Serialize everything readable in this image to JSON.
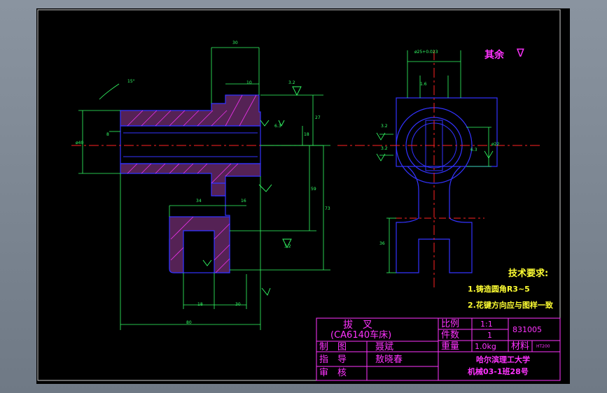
{
  "colors": {
    "background": "#000000",
    "outline": "#3333ff",
    "dimension": "#33ff66",
    "hatch": "#ff33ff",
    "centerline": "#ff2222",
    "title_block": "#ff33ff",
    "notes": "#ffff33"
  },
  "annotation": {
    "other_label": "其余",
    "roughness_symbol": "∇"
  },
  "tech_requirements": {
    "title": "技术要求:",
    "items": [
      "1.铸造圆角R3~5",
      "2.花键方向应与图样一致"
    ]
  },
  "title_block": {
    "part_name": "拔　叉",
    "machine": "(CA6140车床)",
    "scale_label": "比例",
    "scale_value": "1:1",
    "qty_label": "件数",
    "qty_value": "1",
    "weight_label": "重量",
    "weight_value": "1.0kg",
    "material_label": "材料",
    "material_value": "HT200",
    "drawing_no": "831005",
    "drawn_label": "制　图",
    "drawn_name": "聂斌",
    "guide_label": "指　导",
    "guide_name": "敖晓春",
    "review_label": "审　核",
    "review_name": "",
    "school": "哈尔滨理工大学",
    "class_info": "机械03-1班28号"
  },
  "dimensions": {
    "d30": "30",
    "d10a": "10",
    "d18": "18",
    "d27": "27",
    "d40": "40",
    "d59": "59",
    "d73": "73",
    "d34": "34",
    "d16": "16",
    "d30b": "30",
    "d80": "80",
    "d8": "8",
    "d36": "36",
    "angle": "15°",
    "roughness_32": "3.2",
    "roughness_63": "6.3",
    "roughness_16": "1.6",
    "dia_top": "ø25+0.023",
    "dia_right": "ø22",
    "dia_left": "ø40"
  }
}
